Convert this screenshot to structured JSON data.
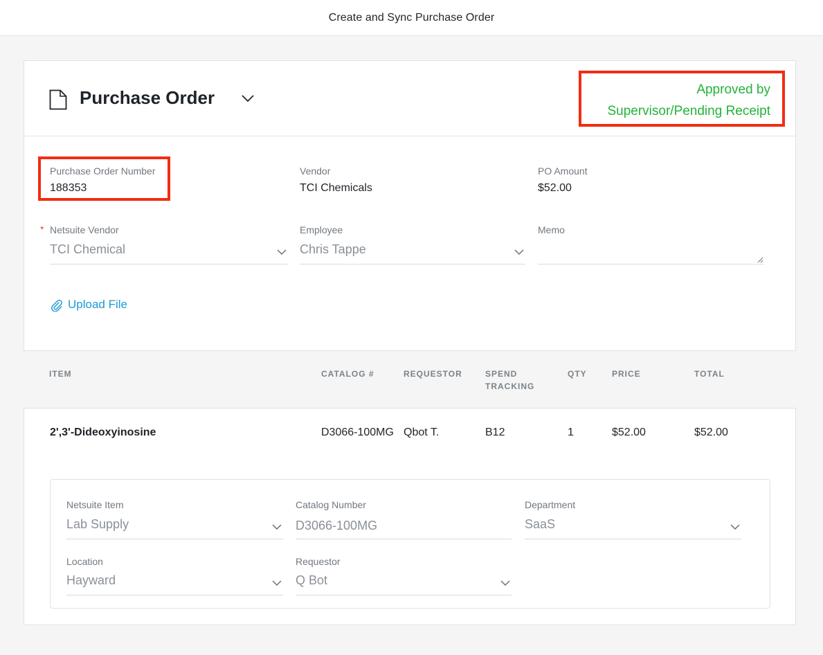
{
  "topbar": {
    "title": "Create and Sync Purchase Order"
  },
  "header": {
    "title": "Purchase Order",
    "status_line1": "Approved by",
    "status_line2": "Supervisor/Pending Receipt"
  },
  "colors": {
    "status_green": "#22b33a",
    "highlight_red": "#f22d12",
    "link_blue": "#1b9ad6",
    "required_red": "#e8432b"
  },
  "summary": {
    "po_number_label": "Purchase Order Number",
    "po_number": "188353",
    "vendor_label": "Vendor",
    "vendor": "TCI Chemicals",
    "amount_label": "PO Amount",
    "amount": "$52.00"
  },
  "form": {
    "required_mark": "*",
    "netsuite_vendor_label": "Netsuite Vendor",
    "netsuite_vendor_value": "TCI Chemical",
    "employee_label": "Employee",
    "employee_value": "Chris Tappe",
    "memo_label": "Memo",
    "memo_value": ""
  },
  "upload": {
    "label": "Upload File"
  },
  "table": {
    "headers": {
      "item": "ITEM",
      "catalog": "CATALOG #",
      "requestor": "REQUESTOR",
      "spend1": "SPEND",
      "spend2": "TRACKING",
      "qty": "QTY",
      "price": "PRICE",
      "total": "TOTAL"
    },
    "rows": [
      {
        "item": "2',3'-Dideoxyinosine",
        "catalog": "D3066-100MG",
        "requestor": "Qbot T.",
        "spend_tracking": "B12",
        "qty": "1",
        "price": "$52.00",
        "total": "$52.00"
      }
    ]
  },
  "line_details": {
    "netsuite_item_label": "Netsuite Item",
    "netsuite_item_value": "Lab Supply",
    "catalog_number_label": "Catalog Number",
    "catalog_number_value": "D3066-100MG",
    "department_label": "Department",
    "department_value": "SaaS",
    "location_label": "Location",
    "location_value": "Hayward",
    "requestor_label": "Requestor",
    "requestor_value": "Q Bot"
  }
}
